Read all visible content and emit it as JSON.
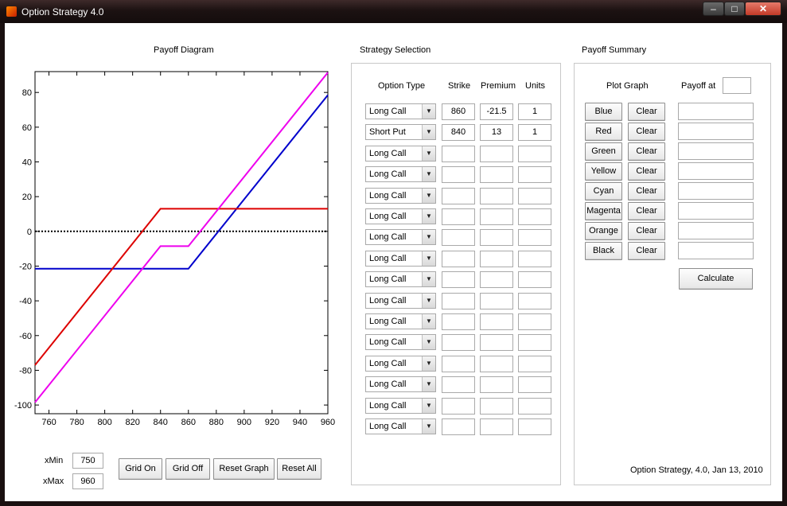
{
  "window": {
    "title": "Option Strategy 4.0",
    "minimize": "–",
    "maximize": "□",
    "close": "✕"
  },
  "payoff": {
    "title": "Payoff Diagram",
    "xmin_label": "xMin",
    "xmin_value": "750",
    "xmax_label": "xMax",
    "xmax_value": "960",
    "grid_on": "Grid On",
    "grid_off": "Grid Off",
    "reset_graph": "Reset Graph",
    "reset_all": "Reset All"
  },
  "chart_data": {
    "type": "line",
    "xlim": [
      750,
      960
    ],
    "ylim": [
      -105,
      92
    ],
    "xticks": [
      760,
      780,
      800,
      820,
      840,
      860,
      880,
      900,
      920,
      940,
      960
    ],
    "yticks": [
      -100,
      -80,
      -60,
      -40,
      -20,
      0,
      20,
      40,
      60,
      80
    ],
    "zero_line_dotted": true,
    "series": [
      {
        "color": "#0000cc",
        "x": [
          750,
          860,
          960
        ],
        "y": [
          -21.5,
          -21.5,
          78.5
        ]
      },
      {
        "color": "#dd0000",
        "x": [
          750,
          840,
          960
        ],
        "y": [
          -77,
          13,
          13
        ]
      },
      {
        "color": "#ee00ee",
        "x": [
          750,
          840,
          860,
          960
        ],
        "y": [
          -98.5,
          -8.5,
          -8.5,
          91.5
        ]
      }
    ]
  },
  "strategy": {
    "title": "Strategy Selection",
    "headers": {
      "type": "Option Type",
      "strike": "Strike",
      "premium": "Premium",
      "units": "Units"
    },
    "rows": [
      {
        "type": "Long Call",
        "strike": "860",
        "premium": "-21.5",
        "units": "1"
      },
      {
        "type": "Short Put",
        "strike": "840",
        "premium": "13",
        "units": "1"
      },
      {
        "type": "Long Call",
        "strike": "",
        "premium": "",
        "units": ""
      },
      {
        "type": "Long Call",
        "strike": "",
        "premium": "",
        "units": ""
      },
      {
        "type": "Long Call",
        "strike": "",
        "premium": "",
        "units": ""
      },
      {
        "type": "Long Call",
        "strike": "",
        "premium": "",
        "units": ""
      },
      {
        "type": "Long Call",
        "strike": "",
        "premium": "",
        "units": ""
      },
      {
        "type": "Long Call",
        "strike": "",
        "premium": "",
        "units": ""
      },
      {
        "type": "Long Call",
        "strike": "",
        "premium": "",
        "units": ""
      },
      {
        "type": "Long Call",
        "strike": "",
        "premium": "",
        "units": ""
      },
      {
        "type": "Long Call",
        "strike": "",
        "premium": "",
        "units": ""
      },
      {
        "type": "Long Call",
        "strike": "",
        "premium": "",
        "units": ""
      },
      {
        "type": "Long Call",
        "strike": "",
        "premium": "",
        "units": ""
      },
      {
        "type": "Long Call",
        "strike": "",
        "premium": "",
        "units": ""
      },
      {
        "type": "Long Call",
        "strike": "",
        "premium": "",
        "units": ""
      },
      {
        "type": "Long Call",
        "strike": "",
        "premium": "",
        "units": ""
      }
    ]
  },
  "summary": {
    "title": "Payoff Summary",
    "plot_graph": "Plot Graph",
    "payoff_at": "Payoff at",
    "payoff_at_value": "",
    "clear_label": "Clear",
    "colors": [
      "Blue",
      "Red",
      "Green",
      "Yellow",
      "Cyan",
      "Magenta",
      "Orange",
      "Black"
    ],
    "results": [
      "",
      "",
      "",
      "",
      "",
      "",
      "",
      ""
    ],
    "calculate": "Calculate",
    "footer": "Option Strategy, 4.0, Jan 13, 2010"
  }
}
